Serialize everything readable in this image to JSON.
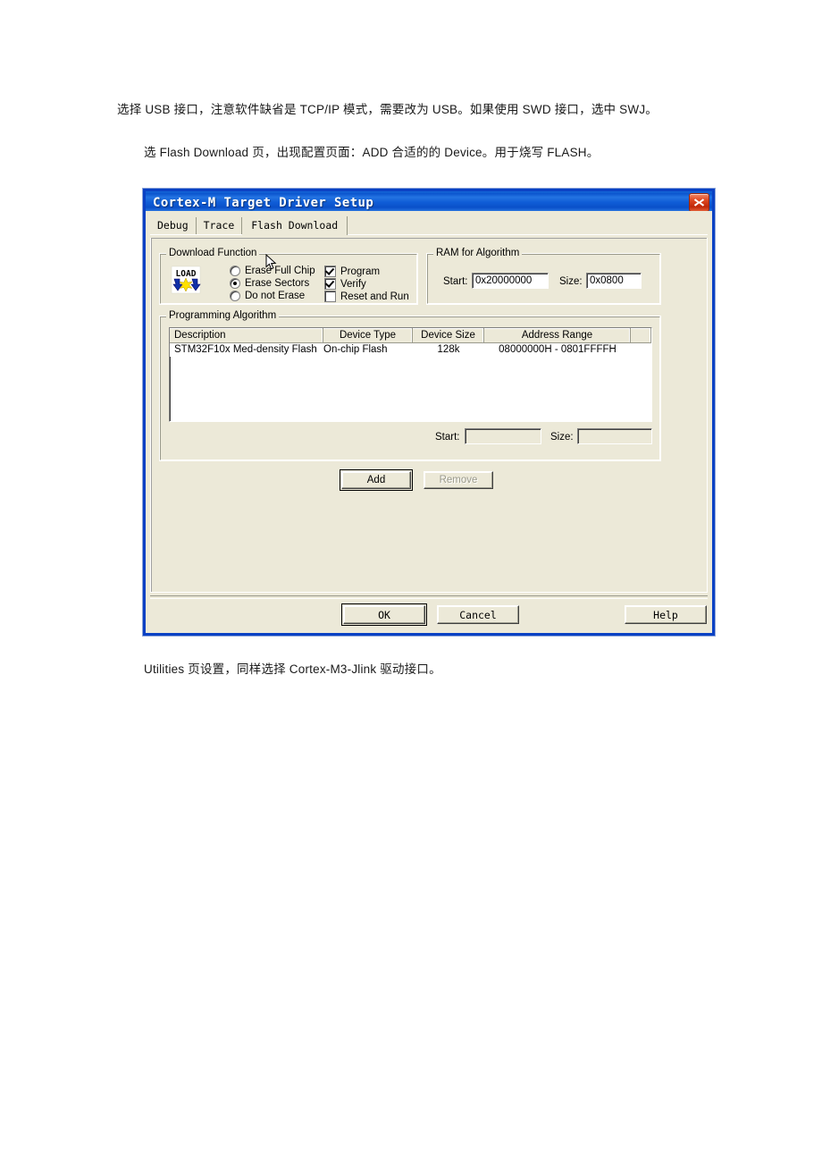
{
  "document": {
    "paragraph_1": "选择 USB 接口，注意软件缺省是 TCP/IP 模式，需要改为 USB。如果使用 SWD 接口，选中 SWJ。",
    "paragraph_2": "选 Flash Download 页，出现配置页面：ADD 合适的的 Device。用于烧写 FLASH。",
    "paragraph_3": "Utilities 页设置，同样选择 Cortex-M3-Jlink 驱动接口。"
  },
  "dialog": {
    "title": "Cortex-M Target Driver Setup",
    "close_icon": "close-icon",
    "tabs": [
      {
        "label": "Debug",
        "active": false
      },
      {
        "label": "Trace",
        "active": false
      },
      {
        "label": "Flash Download",
        "active": true
      }
    ],
    "download_function": {
      "title": "Download Function",
      "icon": "load-icon",
      "icon_label": "LOAD",
      "radios": [
        {
          "label": "Erase Full Chip",
          "checked": false
        },
        {
          "label": "Erase Sectors",
          "checked": true
        },
        {
          "label": "Do not Erase",
          "checked": false
        }
      ],
      "checkboxes": [
        {
          "label": "Program",
          "checked": true
        },
        {
          "label": "Verify",
          "checked": true
        },
        {
          "label": "Reset and Run",
          "checked": false
        }
      ]
    },
    "ram_for_algorithm": {
      "title": "RAM for Algorithm",
      "start_label": "Start:",
      "start_value": "0x20000000",
      "size_label": "Size:",
      "size_value": "0x0800"
    },
    "programming_algorithm": {
      "title": "Programming Algorithm",
      "columns": [
        "Description",
        "Device Type",
        "Device Size",
        "Address Range",
        ""
      ],
      "rows": [
        {
          "description": "STM32F10x Med-density Flash",
          "device_type": "On-chip Flash",
          "device_size": "128k",
          "address_range": "08000000H - 0801FFFFH"
        }
      ],
      "start_label": "Start:",
      "start_value": "",
      "size_label": "Size:",
      "size_value": "",
      "add_button": "Add",
      "remove_button": "Remove",
      "remove_enabled": false
    },
    "buttons": {
      "ok": "OK",
      "cancel": "Cancel",
      "help": "Help"
    }
  },
  "colors": {
    "titlebar_blue": "#0B55CE",
    "dialog_face": "#ECE9D8",
    "close_red": "#C02808",
    "page_background": "#FFFFFF"
  }
}
